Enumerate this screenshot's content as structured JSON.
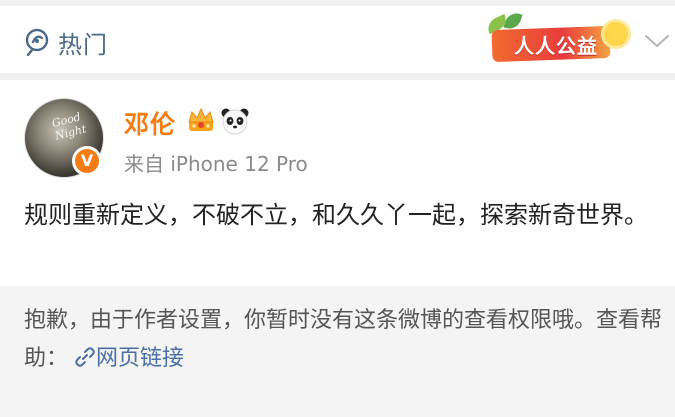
{
  "header": {
    "hot_label": "热门",
    "badge_text": "人人公益"
  },
  "post": {
    "author_name": "邓伦",
    "verified_mark": "V",
    "avatar_script": "Good Night",
    "source": "来自 iPhone 12 Pro",
    "content": "规则重新定义，不破不立，和久久丫一起，探索新奇世界。"
  },
  "notice": {
    "text": "抱歉，由于作者设置，你暂时没有这条微博的查看权限哦。查看帮助：",
    "link_label": "网页链接"
  },
  "colors": {
    "author": "#f47c10",
    "link": "#4a6fa5",
    "hot": "#4a6a8a"
  }
}
